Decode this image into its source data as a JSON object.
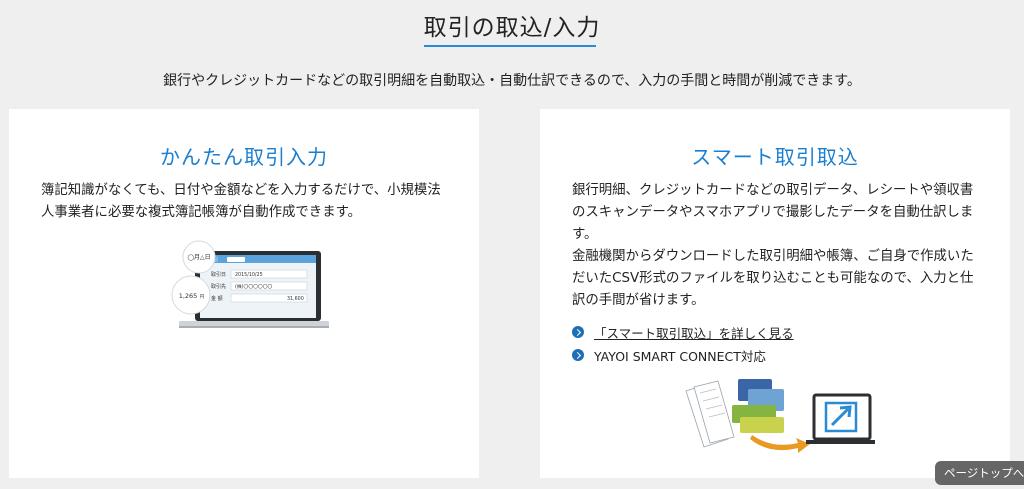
{
  "section": {
    "title": "取引の取込/入力",
    "lead": "銀行やクレジットカードなどの取引明細を自動取込・自動仕訳できるので、入力の手間と時間が削減できます。"
  },
  "left_card": {
    "title": "かんたん取引入力",
    "body": "簿記知識がなくても、日付や金額などを入力するだけで、小規模法人事業者に必要な複式簿記帳簿が自動作成できます。",
    "illustration": {
      "bubble_date": "◯月△日",
      "bubble_amount": "1,265",
      "bubble_amount_unit": "円",
      "form_tab": "取引",
      "row1_label": "取引日",
      "row1_value": "2015/10/25",
      "row2_label": "取引先",
      "row2_value": "(株)〇〇〇〇〇〇",
      "row3_label": "金 額",
      "row3_value": "31,600"
    }
  },
  "right_card": {
    "title": "スマート取引取込",
    "body_p1": "銀行明細、クレジットカードなどの取引データ、レシートや領収書のスキャンデータやスマホアプリで撮影したデータを自動仕訳します。",
    "body_p2": "金融機関からダウンロードした取引明細や帳簿、ご自身で作成いただいたCSV形式のファイルを取り込むことも可能なので、入力と仕訳の手間が省けます。",
    "links": [
      {
        "label": "「スマート取引取込」を詳しく見る",
        "underline": true
      },
      {
        "label": "YAYOI SMART CONNECT対応",
        "underline": false
      }
    ]
  },
  "page_top_label": "ページトップへ",
  "colors": {
    "accent": "#1a7fd0",
    "link_icon": "#1d6fb6",
    "background": "#efefef"
  }
}
